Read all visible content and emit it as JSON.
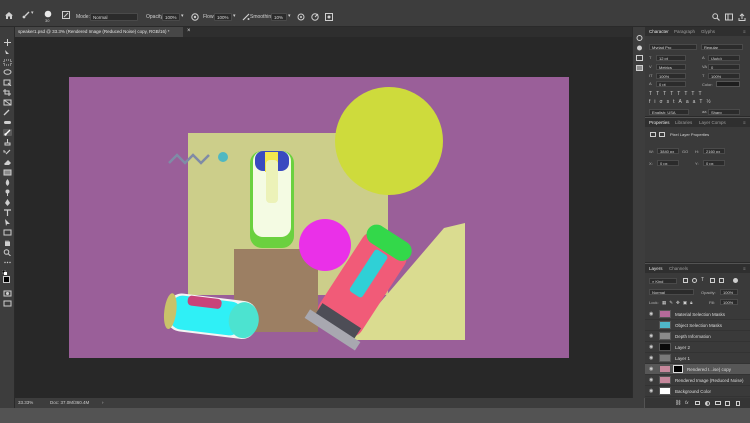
{
  "options_bar": {
    "mode_label": "Mode:",
    "mode_value": "Normal",
    "opacity_label": "Opacity:",
    "opacity_value": "100%",
    "flow_label": "Flow:",
    "flow_value": "100%",
    "smoothing_label": "Smoothing:",
    "smoothing_value": "10%",
    "brush_size": "30"
  },
  "document": {
    "tab_title": "speaker1.psd @ 33.3% (Rendered Image (Reduced Noise) copy, RGB/16) *"
  },
  "status_bar": {
    "zoom": "33.33%",
    "doc_info": "Doc: 37.0M/360.4M"
  },
  "character_panel": {
    "tabs": [
      "Character",
      "Paragraph",
      "Glyphs"
    ],
    "font_family": "Myriad Pro",
    "font_style": "Regular",
    "font_size": "12 pt",
    "leading": "(Auto)",
    "kerning": "Metrics",
    "tracking": "0",
    "vertical_scale": "100%",
    "horizontal_scale": "100%",
    "baseline_shift": "0 pt",
    "color_label": "Color:",
    "language": "English: USA",
    "antialias": "Sharp"
  },
  "properties_panel": {
    "tabs": [
      "Properties",
      "Libraries",
      "Layer Comps"
    ],
    "layer_type": "Pixel Layer Properties",
    "w_label": "W:",
    "w_value": "3840 px",
    "go_label": "GO",
    "h_label": "H:",
    "h_value": "2160 px",
    "x_label": "X:",
    "x_value": "0 px",
    "y_label": "Y:",
    "y_value": "0 px"
  },
  "layers_panel": {
    "tabs": [
      "Layers",
      "Channels"
    ],
    "filter_value": "Kind",
    "blend_mode": "Normal",
    "opacity_label": "Opacity:",
    "opacity_value": "100%",
    "lock_label": "Lock:",
    "fill_label": "Fill:",
    "fill_value": "100%",
    "layers": [
      {
        "name": "Material Selection Masks",
        "visible": true,
        "thumb": "#b56a9a"
      },
      {
        "name": "Object Selection Masks",
        "visible": false,
        "thumb": "#4fb7c9"
      },
      {
        "name": "Depth Information",
        "visible": true,
        "thumb": "#8a8a8a"
      },
      {
        "name": "Layer 2",
        "visible": true,
        "thumb": "#0a0a0a"
      },
      {
        "name": "Layer 1",
        "visible": true,
        "thumb": "#7a7a7a"
      },
      {
        "name": "Rendered I...ise) copy",
        "visible": true,
        "thumb": "#c7889c",
        "selected": true
      },
      {
        "name": "Rendered Image (Reduced Noise)",
        "visible": true,
        "thumb": "#c7889c"
      },
      {
        "name": "Background Color",
        "visible": true,
        "thumb": "#ffffff"
      }
    ]
  },
  "colors": {
    "canvas_bg": "#9a5f99",
    "square": "#ccce8a",
    "yellow_circle": "#cedb3c",
    "magenta_circle": "#ea30e8",
    "brown_box": "#9c7f63",
    "ramp": "#dadc90"
  }
}
